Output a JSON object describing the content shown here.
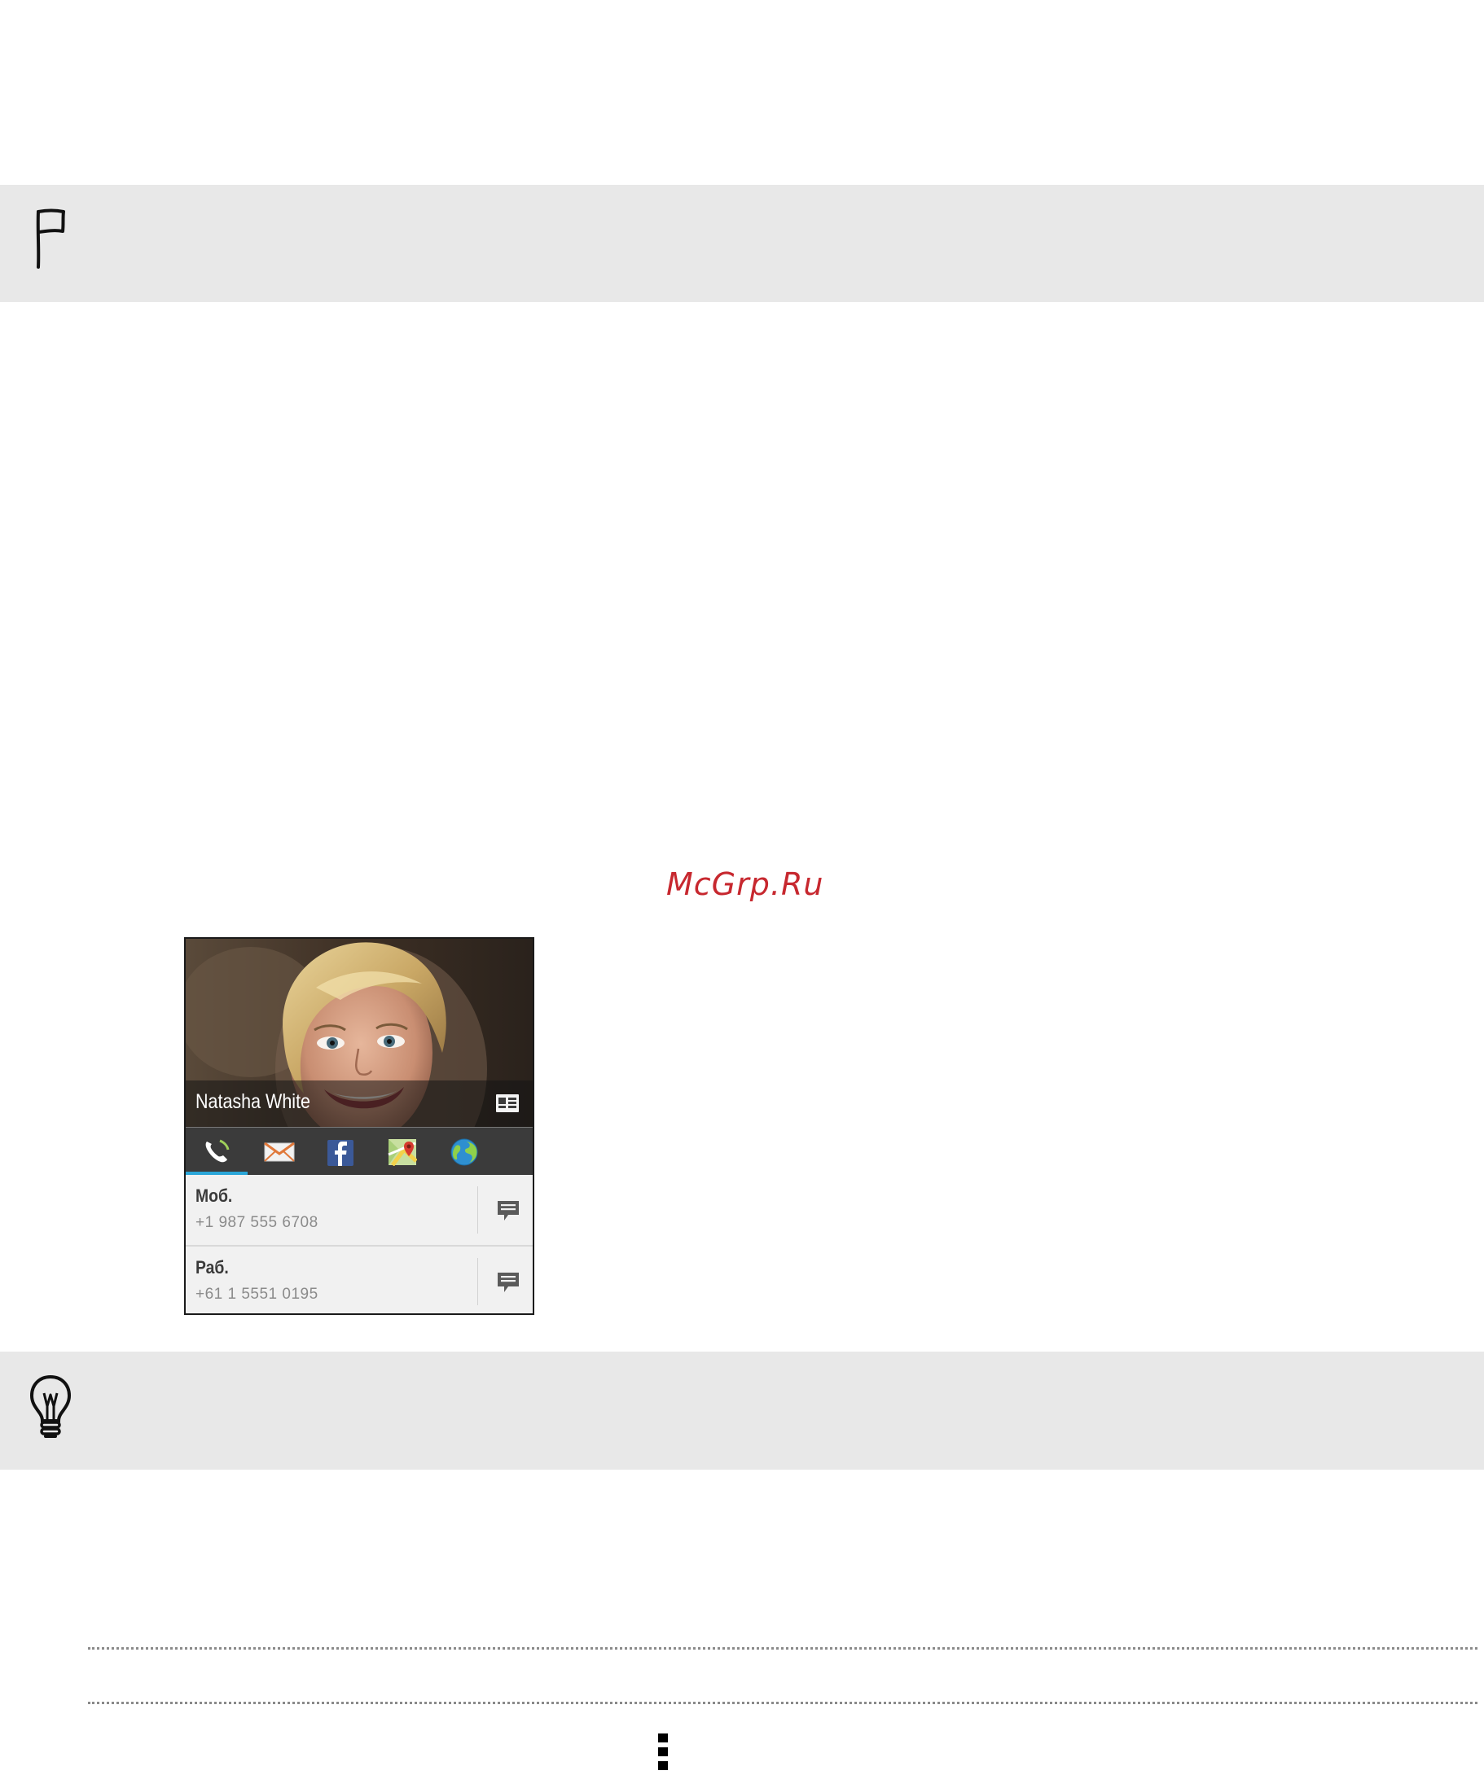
{
  "watermark": "McGrp.Ru",
  "notes": {
    "flag_icon": "flag-icon",
    "tip_icon": "lightbulb-icon"
  },
  "contact_card": {
    "name": "Natasha White",
    "vcard_icon": "contact-card-icon",
    "tabs": [
      {
        "icon": "phone-icon",
        "active": true
      },
      {
        "icon": "mail-icon",
        "active": false
      },
      {
        "icon": "facebook-icon",
        "active": false
      },
      {
        "icon": "map-icon",
        "active": false
      },
      {
        "icon": "globe-icon",
        "active": false
      }
    ],
    "numbers": [
      {
        "label": "Моб.",
        "number": "+1 987 555 6708"
      },
      {
        "label": "Раб.",
        "number": "+61 1 5551 0195"
      }
    ],
    "colors": {
      "tab_bar": "#3b3b3b",
      "active_tab_indicator": "#2aa6d8",
      "watermark": "#c7282f"
    }
  },
  "overflow_menu_icon": "more-vertical-icon"
}
